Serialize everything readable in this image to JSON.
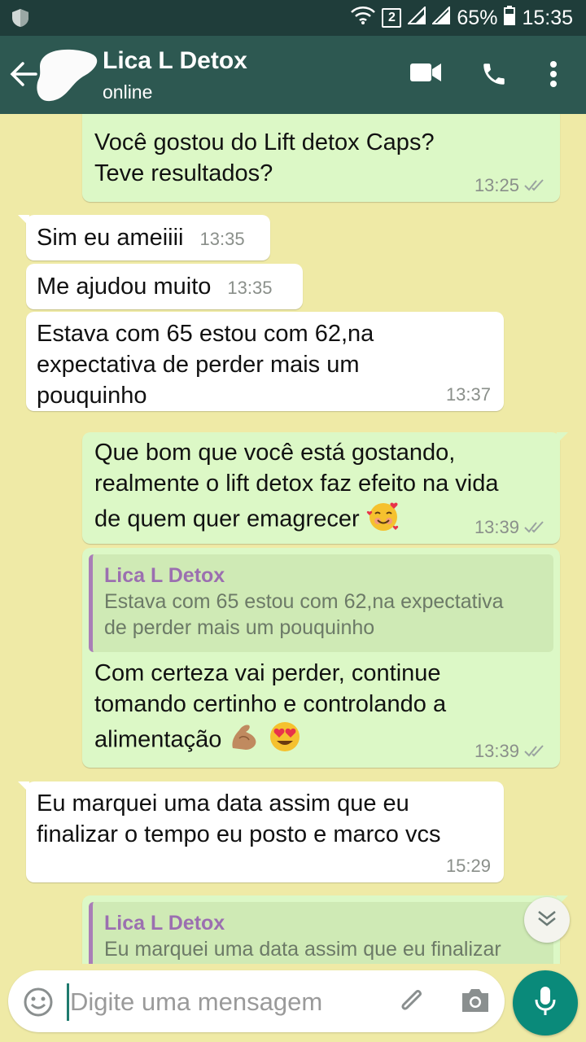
{
  "status_bar": {
    "sim_badge": "2",
    "battery": "65%",
    "time": "15:35"
  },
  "header": {
    "contact_name": "Lica L Detox",
    "status": "online"
  },
  "messages": [
    {
      "dir": "out",
      "text_lines": [
        "Você gostou do Lift detox Caps?",
        "Teve resultados?"
      ],
      "time": "13:25"
    },
    {
      "dir": "in",
      "text": "Sim eu ameiiii",
      "time": "13:35"
    },
    {
      "dir": "in",
      "text": "Me ajudou muito",
      "time": "13:35"
    },
    {
      "dir": "in",
      "text_lines": [
        "Estava com 65 estou com 62,na",
        "expectativa de perder mais um",
        "pouquinho"
      ],
      "time": "13:37"
    },
    {
      "dir": "out",
      "text_lines": [
        "Que bom que você está gostando,",
        "realmente o lift detox faz efeito na vida",
        "de quem quer emagrecer"
      ],
      "emoji": "smiling-face-with-hearts",
      "time": "13:39"
    },
    {
      "dir": "out",
      "quote": {
        "name": "Lica L Detox",
        "lines": [
          "Estava com 65 estou com 62,na expectativa",
          "de perder mais um pouquinho"
        ]
      },
      "text_lines": [
        "Com certeza vai perder, continue",
        "tomando certinho e controlando a",
        "alimentação"
      ],
      "emojis": [
        "flexed-biceps",
        "heart-eyes"
      ],
      "time": "13:39"
    },
    {
      "dir": "in",
      "text_lines": [
        "Eu marquei uma data assim que eu",
        "finalizar o tempo eu posto e marco vcs"
      ],
      "time": "15:29"
    },
    {
      "dir": "out",
      "quote": {
        "name": "Lica L Detox",
        "lines": [
          "Eu marquei uma data assim que eu finalizar"
        ]
      }
    }
  ],
  "input": {
    "placeholder": "Digite uma mensagem"
  },
  "colors": {
    "header": "#2d5851",
    "status_bar": "#1f3d3a",
    "chat_bg": "#efeaa6",
    "outgoing": "#dcf8c6",
    "incoming": "#ffffff",
    "quote_accent": "#9b6fb0",
    "mic": "#0a8a7a"
  }
}
